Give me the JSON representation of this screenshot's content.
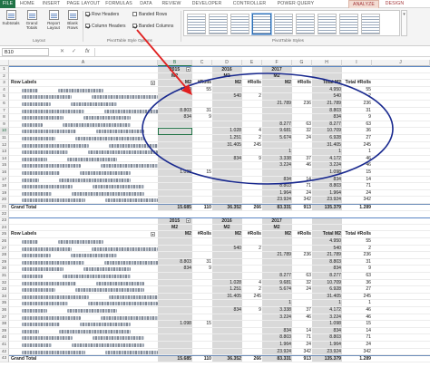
{
  "tabs": [
    "FILE",
    "HOME",
    "INSERT",
    "PAGE LAYOUT",
    "FORMULAS",
    "DATA",
    "REVIEW",
    "DEVELOPER",
    "CONTROLLER",
    "POWER QUERY",
    "ANALYZE",
    "DESIGN"
  ],
  "ribbon": {
    "buttons": [
      "Subtotals",
      "Grand Totals",
      "Report Layout",
      "Blank Rows"
    ],
    "layout_group": "Layout",
    "options": [
      {
        "label": "Row Headers",
        "checked": true
      },
      {
        "label": "Banded Rows",
        "checked": false
      },
      {
        "label": "Column Headers",
        "checked": true
      },
      {
        "label": "Banded Columns",
        "checked": true
      }
    ],
    "options_group": "PivotTable Style Options",
    "styles_group": "PivotTable Styles"
  },
  "formula_bar": {
    "name_box": "B10",
    "fx": "fx",
    "value": ""
  },
  "columns": [
    "A",
    "B",
    "C",
    "D",
    "E",
    "F",
    "G",
    "H",
    "I",
    "J"
  ],
  "selected_column": "B",
  "selected_row": "10",
  "pivot1": {
    "years": [
      "2015",
      "2016",
      "2017"
    ],
    "year_rows": [
      "1",
      "2"
    ],
    "header_row": "3",
    "header_labels": {
      "row_labels": "Row Labels",
      "m2": "M2",
      "rolls": "#Rolls",
      "total_m2": "Total M2",
      "total_rolls": "Total #Rolls"
    },
    "rows": [
      {
        "r": "4",
        "b": "4.950",
        "c": "55",
        "d": "",
        "e": "",
        "f": "",
        "g": "",
        "h": "4.950",
        "i": "55"
      },
      {
        "r": "5",
        "b": "",
        "c": "",
        "d": "540",
        "e": "2",
        "f": "",
        "g": "",
        "h": "540",
        "i": "2"
      },
      {
        "r": "6",
        "b": "",
        "c": "",
        "d": "",
        "e": "",
        "f": "21.789",
        "g": "236",
        "h": "21.789",
        "i": "236"
      },
      {
        "r": "7",
        "b": "8.803",
        "c": "31",
        "d": "",
        "e": "",
        "f": "",
        "g": "",
        "h": "8.803",
        "i": "31"
      },
      {
        "r": "8",
        "b": "834",
        "c": "9",
        "d": "",
        "e": "",
        "f": "",
        "g": "",
        "h": "834",
        "i": "9"
      },
      {
        "r": "9",
        "b": "",
        "c": "",
        "d": "",
        "e": "",
        "f": "8.277",
        "g": "63",
        "h": "8.277",
        "i": "63"
      },
      {
        "r": "10",
        "b": "",
        "c": "",
        "d": "1.028",
        "e": "4",
        "f": "9.681",
        "g": "32",
        "h": "10.709",
        "i": "36"
      },
      {
        "r": "11",
        "b": "",
        "c": "",
        "d": "1.251",
        "e": "2",
        "f": "5.674",
        "g": "24",
        "h": "6.928",
        "i": "27"
      },
      {
        "r": "12",
        "b": "",
        "c": "",
        "d": "31.405",
        "e": "245",
        "f": "",
        "g": "",
        "h": "31.405",
        "i": "245"
      },
      {
        "r": "13",
        "b": "",
        "c": "",
        "d": "",
        "e": "",
        "f": "1",
        "g": "",
        "h": "1",
        "i": "1"
      },
      {
        "r": "14",
        "b": "",
        "c": "",
        "d": "834",
        "e": "9",
        "f": "3.338",
        "g": "37",
        "h": "4.172",
        "i": "46"
      },
      {
        "r": "15",
        "b": "",
        "c": "",
        "d": "",
        "e": "",
        "f": "3.224",
        "g": "46",
        "h": "3.224",
        "i": "46"
      },
      {
        "r": "16",
        "b": "1.098",
        "c": "15",
        "d": "",
        "e": "",
        "f": "",
        "g": "",
        "h": "1.098",
        "i": "15"
      },
      {
        "r": "17",
        "b": "",
        "c": "",
        "d": "",
        "e": "",
        "f": "834",
        "g": "14",
        "h": "834",
        "i": "14"
      },
      {
        "r": "18",
        "b": "",
        "c": "",
        "d": "",
        "e": "",
        "f": "8.803",
        "g": "71",
        "h": "8.803",
        "i": "71"
      },
      {
        "r": "19",
        "b": "",
        "c": "",
        "d": "",
        "e": "",
        "f": "1.964",
        "g": "24",
        "h": "1.964",
        "i": "24"
      },
      {
        "r": "20",
        "b": "",
        "c": "",
        "d": "",
        "e": "",
        "f": "23.924",
        "g": "342",
        "h": "23.924",
        "i": "342"
      }
    ],
    "total": {
      "r": "21",
      "label": "Grand Total",
      "b": "15.685",
      "c": "110",
      "d": "36.352",
      "e": "266",
      "f": "83.331",
      "g": "913",
      "h": "135.379",
      "i": "1.289"
    }
  },
  "gap_row": "22",
  "pivot2": {
    "years": [
      "2015",
      "2016",
      "2017"
    ],
    "year_rows": [
      "23",
      "24"
    ],
    "header_row": "25",
    "header_labels": {
      "row_labels": "Row Labels",
      "m2": "M2",
      "rolls": "#Rolls",
      "total_m2": "Total M2",
      "total_rolls": "Total #Rolls"
    },
    "rows": [
      {
        "r": "26",
        "b": "",
        "c": "",
        "d": "",
        "e": "",
        "f": "",
        "g": "",
        "h": "4.950",
        "i": "55"
      },
      {
        "r": "27",
        "b": "",
        "c": "",
        "d": "540",
        "e": "2",
        "f": "",
        "g": "",
        "h": "540",
        "i": "2"
      },
      {
        "r": "28",
        "b": "",
        "c": "",
        "d": "",
        "e": "",
        "f": "21.789",
        "g": "236",
        "h": "21.789",
        "i": "236"
      },
      {
        "r": "29",
        "b": "8.803",
        "c": "31",
        "d": "",
        "e": "",
        "f": "",
        "g": "",
        "h": "8.803",
        "i": "31"
      },
      {
        "r": "30",
        "b": "834",
        "c": "9",
        "d": "",
        "e": "",
        "f": "",
        "g": "",
        "h": "834",
        "i": "9"
      },
      {
        "r": "31",
        "b": "",
        "c": "",
        "d": "",
        "e": "",
        "f": "8.277",
        "g": "63",
        "h": "8.277",
        "i": "63"
      },
      {
        "r": "32",
        "b": "",
        "c": "",
        "d": "1.028",
        "e": "4",
        "f": "9.681",
        "g": "32",
        "h": "10.709",
        "i": "36"
      },
      {
        "r": "33",
        "b": "",
        "c": "",
        "d": "1.251",
        "e": "2",
        "f": "5.674",
        "g": "24",
        "h": "6.928",
        "i": "27"
      },
      {
        "r": "34",
        "b": "",
        "c": "",
        "d": "31.405",
        "e": "245",
        "f": "",
        "g": "",
        "h": "31.405",
        "i": "245"
      },
      {
        "r": "35",
        "b": "",
        "c": "",
        "d": "",
        "e": "",
        "f": "1",
        "g": "",
        "h": "1",
        "i": "1"
      },
      {
        "r": "36",
        "b": "",
        "c": "",
        "d": "834",
        "e": "9",
        "f": "3.338",
        "g": "37",
        "h": "4.172",
        "i": "46"
      },
      {
        "r": "37",
        "b": "",
        "c": "",
        "d": "",
        "e": "",
        "f": "3.224",
        "g": "46",
        "h": "3.224",
        "i": "46"
      },
      {
        "r": "38",
        "b": "1.098",
        "c": "15",
        "d": "",
        "e": "",
        "f": "",
        "g": "",
        "h": "1.098",
        "i": "15"
      },
      {
        "r": "39",
        "b": "",
        "c": "",
        "d": "",
        "e": "",
        "f": "834",
        "g": "14",
        "h": "834",
        "i": "14"
      },
      {
        "r": "40",
        "b": "",
        "c": "",
        "d": "",
        "e": "",
        "f": "8.803",
        "g": "71",
        "h": "8.803",
        "i": "71"
      },
      {
        "r": "41",
        "b": "",
        "c": "",
        "d": "",
        "e": "",
        "f": "1.964",
        "g": "24",
        "h": "1.964",
        "i": "24"
      },
      {
        "r": "42",
        "b": "",
        "c": "",
        "d": "",
        "e": "",
        "f": "23.924",
        "g": "342",
        "h": "23.924",
        "i": "342"
      }
    ],
    "total": {
      "r": "43",
      "label": "Grand Total",
      "b": "15.685",
      "c": "110",
      "d": "36.352",
      "e": "266",
      "f": "83.331",
      "g": "913",
      "h": "135.379",
      "i": "1.289"
    }
  },
  "colors": {
    "excel_green": "#217346",
    "column_band": "#d9d9d9",
    "annotation": "#1a2a8f",
    "arrow": "#e02020"
  }
}
